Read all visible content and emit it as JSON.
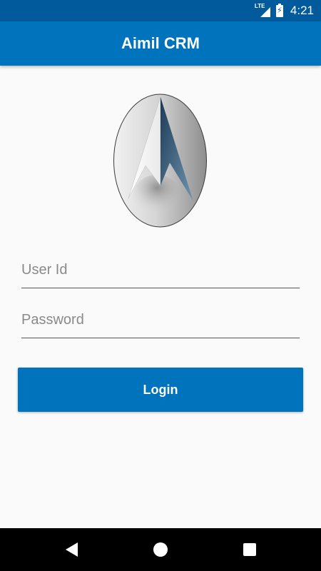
{
  "status_bar": {
    "network_label": "LTE",
    "time": "4:21",
    "icons": [
      "signal-icon",
      "battery-charging-icon"
    ]
  },
  "app_bar": {
    "title": "Aimil CRM"
  },
  "logo": {
    "icon": "aimil-logo"
  },
  "form": {
    "user_id": {
      "value": "",
      "placeholder": "User Id"
    },
    "password": {
      "value": "",
      "placeholder": "Password"
    },
    "login_label": "Login"
  },
  "nav_bar": {
    "icons": [
      "back-icon",
      "home-icon",
      "recents-icon"
    ]
  },
  "colors": {
    "status_bar": "#005a9c",
    "primary": "#0073bd",
    "background": "#fafafa",
    "nav_bar": "#000000"
  }
}
